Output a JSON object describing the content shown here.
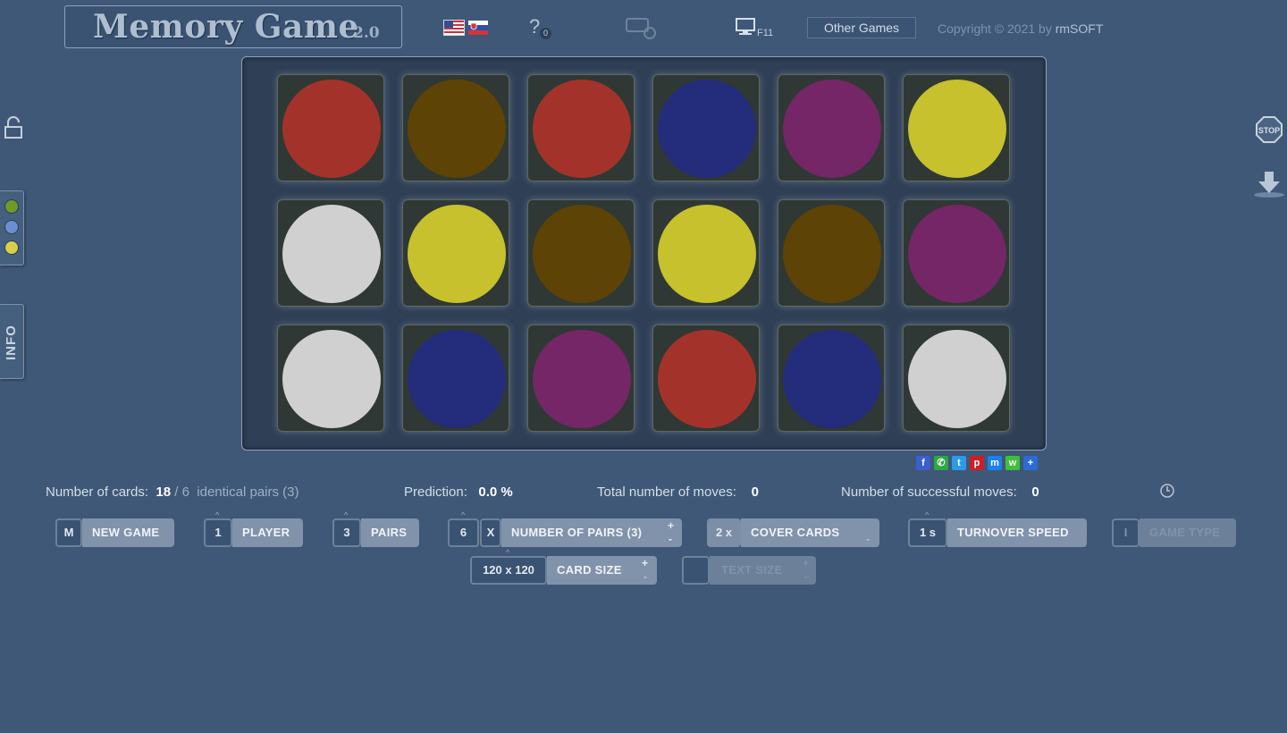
{
  "header": {
    "title": "Memory Game",
    "version": "2.0",
    "help_badge": "0",
    "fullscreen_key": "F11",
    "other_games": "Other Games",
    "copyright_prefix": "Copyright © 2021 by",
    "copyright_brand": "rmSOFT",
    "languages": [
      "english-flag",
      "slovak-flag"
    ]
  },
  "sidebar": {
    "theme_colors": [
      "#6f9a2a",
      "#6a8fd1",
      "#d9cf4a"
    ],
    "info_tab": "INFO"
  },
  "board": {
    "rows": 3,
    "cols": 6,
    "cards": [
      "#a3332a",
      "#5e4306",
      "#a3332a",
      "#242c7c",
      "#742667",
      "#c6c12c",
      "#d0d0d0",
      "#c6c12c",
      "#5e4306",
      "#c6c12c",
      "#5e4306",
      "#742667",
      "#d0d0d0",
      "#242c7c",
      "#742667",
      "#a3332a",
      "#242c7c",
      "#d0d0d0"
    ]
  },
  "share": [
    {
      "name": "facebook-icon",
      "glyph": "f",
      "color": "#3b5ed0"
    },
    {
      "name": "whatsapp-icon",
      "glyph": "✆",
      "color": "#2da845"
    },
    {
      "name": "twitter-icon",
      "glyph": "t",
      "color": "#2b9ae8"
    },
    {
      "name": "pinterest-icon",
      "glyph": "p",
      "color": "#c8202a"
    },
    {
      "name": "messenger-icon",
      "glyph": "m",
      "color": "#1d7ff0"
    },
    {
      "name": "wechat-icon",
      "glyph": "w",
      "color": "#3fbf3a"
    },
    {
      "name": "share-more-icon",
      "glyph": "+",
      "color": "#2b6bd6"
    }
  ],
  "stats": {
    "cards_label": "Number of cards:",
    "cards_value": "18",
    "cards_sep": " / ",
    "pairs_total": "6",
    "pairs_label": "identical pairs (3)",
    "prediction_label": "Prediction:",
    "prediction_value": "0.0 %",
    "moves_label": "Total number of moves:",
    "moves_value": "0",
    "success_label": "Number of successful moves:",
    "success_value": "0"
  },
  "controls": {
    "new_game_key": "M",
    "new_game": "NEW GAME",
    "player_value": "1",
    "player": "PLAYER",
    "pairs_value": "3",
    "pairs": "PAIRS",
    "num_pairs_value": "6",
    "num_pairs_key": "X",
    "num_pairs": "NUMBER OF PAIRS (3)",
    "cover_value": "2 x",
    "cover": "COVER CARDS",
    "speed_value": "1 s",
    "speed": "TURNOVER SPEED",
    "game_type_key": "I",
    "game_type": "GAME TYPE",
    "card_size_value": "120 x 120",
    "card_size": "CARD SIZE",
    "text_size": "TEXT SIZE",
    "plus": "+",
    "minus": "-",
    "caret": "^"
  }
}
